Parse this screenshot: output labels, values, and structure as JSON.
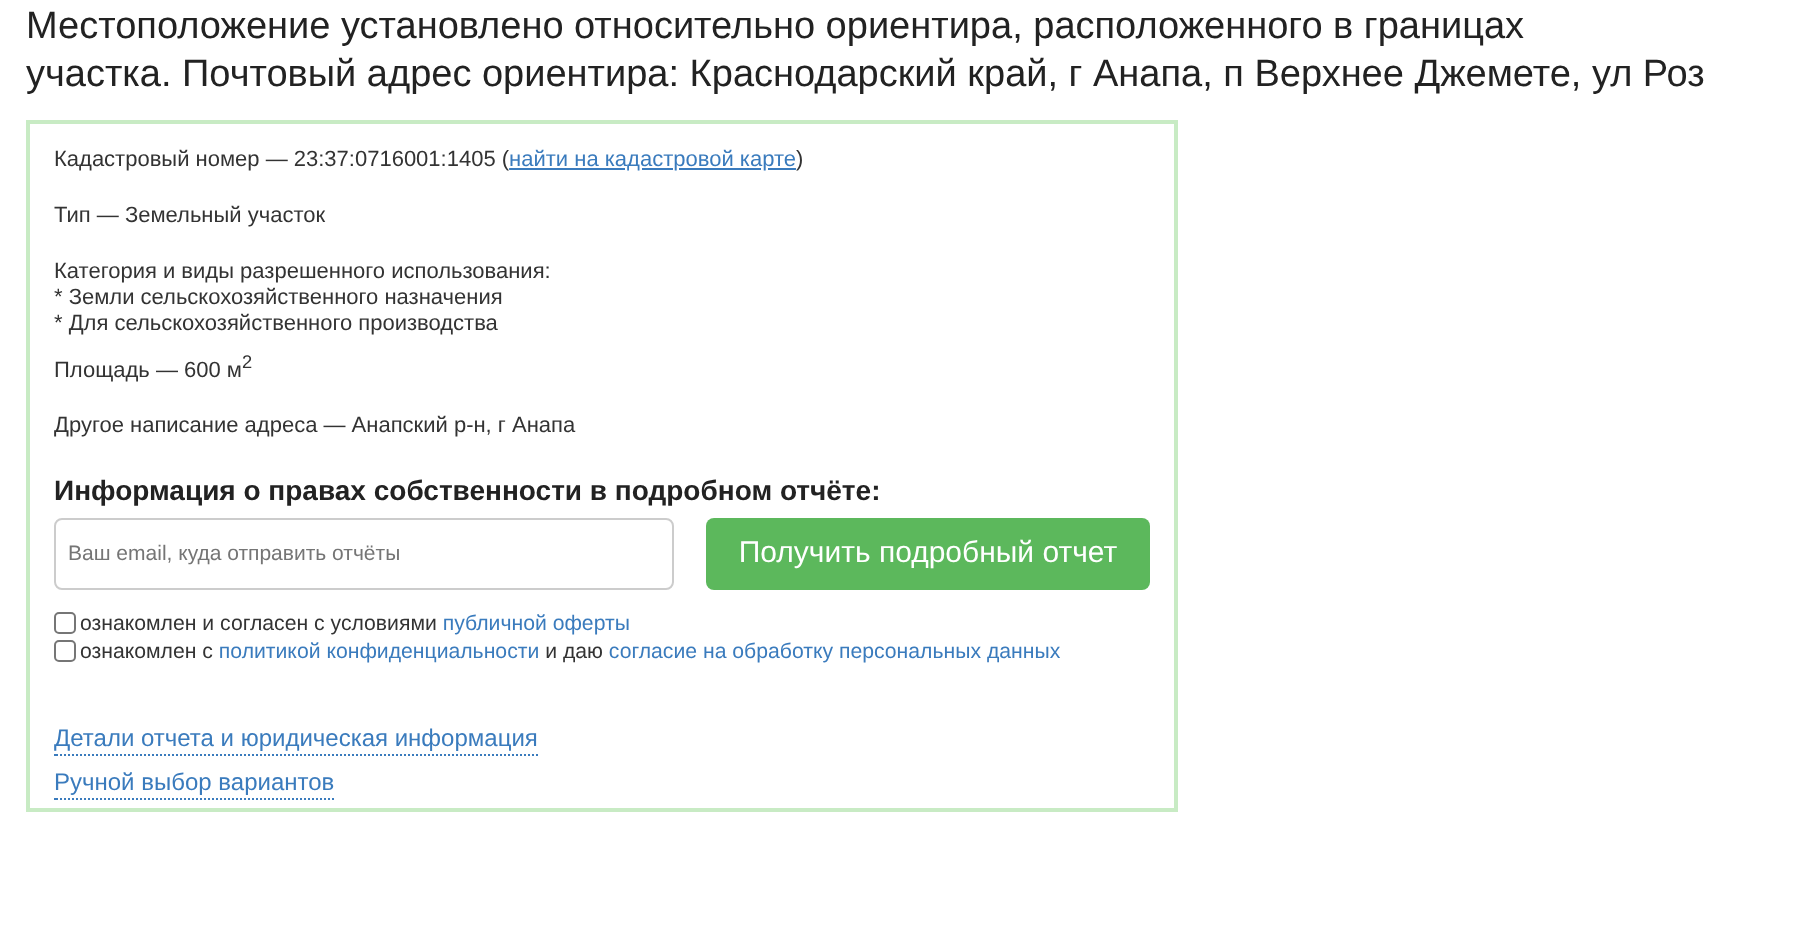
{
  "title_lines": [
    "Местоположение установлено относительно ориентира, расположенного в границах",
    "участка. Почтовый адрес ориентира: Краснодарский край, г Анапа, п Верхнее Джемете, ул Роз"
  ],
  "card": {
    "cadastral": {
      "text": "Кадастровый номер — 23:37:0716001:1405 (",
      "link": "найти на кадастровой карте",
      "tail": ")"
    },
    "type": "Тип — Земельный участок",
    "category_lines": [
      "Категория и виды разрешенного использования:",
      "* Земли сельскохозяйственного назначения",
      "* Для сельскохозяйственного производства"
    ],
    "area": "Площадь — 600 м$^{2}$",
    "alt_address": "Другое написание адреса — Анапский р-н, г Анапа",
    "rights_heading": "Информация о правах собственности в подробном отчёте:",
    "email": {
      "placeholder": "Ваш email, куда отправить отчёты"
    },
    "submit": "Получить подробный отчет",
    "agreements": [
      {
        "checked": false,
        "parts": [
          {
            "kind": "text",
            "text": "ознакомлен и согласен с условиями "
          },
          {
            "kind": "link",
            "text": "публичной оферты"
          }
        ]
      },
      {
        "checked": false,
        "parts": [
          {
            "kind": "text",
            "text": "ознакомлен с "
          },
          {
            "kind": "link",
            "text": "политикой конфиденциальности"
          },
          {
            "kind": "text",
            "text": " и даю "
          },
          {
            "kind": "link",
            "text": "согласие на обработку персональных данных"
          }
        ]
      }
    ],
    "footer_links": [
      "Детали отчета и юридическая информация",
      "Ручной выбор вариантов"
    ]
  }
}
